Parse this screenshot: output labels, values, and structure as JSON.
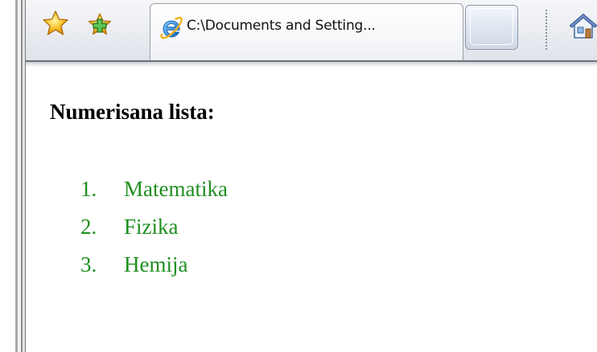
{
  "toolbar": {
    "favorites_icon": "favorites-star-icon",
    "add_favorites_icon": "add-to-favorites-icon",
    "home_icon": "home-icon"
  },
  "tabs": [
    {
      "title": "C:\\Documents and Setting...",
      "icon": "internet-explorer-icon",
      "active": true
    },
    {
      "title": "",
      "icon": "",
      "active": false
    }
  ],
  "page": {
    "heading": "Numerisana lista:",
    "list_color": "#1f8f1f",
    "items": [
      {
        "number": "1.",
        "label": "Matematika"
      },
      {
        "number": "2.",
        "label": "Fizika"
      },
      {
        "number": "3.",
        "label": "Hemija"
      }
    ]
  }
}
